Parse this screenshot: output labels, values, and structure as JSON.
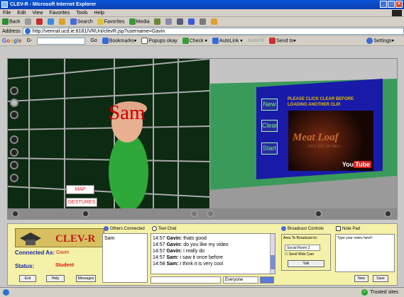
{
  "window": {
    "title": "CLEV-R - Microsoft Internet Explorer",
    "buttons": [
      "_",
      "□",
      "×"
    ]
  },
  "menu": [
    "File",
    "Edit",
    "View",
    "Favorites",
    "Tools",
    "Help"
  ],
  "toolbar": {
    "back": "Back",
    "search": "Search",
    "favorites": "Favorites",
    "media": "Media"
  },
  "address": {
    "label": "Address",
    "url": "http://vermal.ucd.ie:8181/VRUni/clevR.jsp?username=Gavin"
  },
  "google": {
    "logo": "Google",
    "g_label": "G-",
    "go": "Go",
    "bookmarks": "Bookmarks▾",
    "popups": "Popups okay",
    "check": "Check ▾",
    "autolink": "AutoLink ▾",
    "autofill": "AutoFill",
    "sendto": "Send to▾",
    "settings": "Settings▾"
  },
  "scene": {
    "avatar_name": "Sam",
    "map_button": "MAP",
    "gestures_button": "GESTURES",
    "panel_buttons": {
      "new": "New",
      "clear": "Clear",
      "start": "Start"
    },
    "note": "PLEASE CLICK CLEAR BEFORE LOADING ANOTHER CLIP.",
    "video": {
      "title": "Meat Loaf",
      "subtitle": "HITS OUT OF HELL",
      "brand_you": "You",
      "brand_tube": "Tube"
    }
  },
  "panel": {
    "brand": "CLEV-R",
    "connected_label": "Connected As:",
    "connected_value": "Gavin",
    "status_label": "Status:",
    "status_value": "Student",
    "buttons": {
      "exit": "Exit",
      "help": "Help",
      "messages": "Messages"
    },
    "others": {
      "title": "Others Connected",
      "users": [
        "Sam"
      ]
    },
    "chat": {
      "title": "Text Chat",
      "messages": [
        {
          "time": "14:57",
          "user": "Gavin:",
          "text": "thats good"
        },
        {
          "time": "14:57",
          "user": "Gavin:",
          "text": "do you like my video"
        },
        {
          "time": "14:57",
          "user": "Gavin:",
          "text": "i really do"
        },
        {
          "time": "14:57",
          "user": "Sam:",
          "text": "i saw it once before"
        },
        {
          "time": "14:58",
          "user": "Sam:",
          "text": "i think it is very cool"
        }
      ],
      "recipient": "Everyone"
    },
    "broadcast": {
      "title": "Broadcast Controls",
      "label": "Area To Broadcast to:",
      "room": "Social Room 2",
      "webcam": "Send Web Cam",
      "talk": "Talk"
    },
    "notepad": {
      "title": "Note Pad",
      "placeholder": "Type your notes here!!",
      "new": "New",
      "save": "Save"
    }
  },
  "statusbar": {
    "zone": "Trusted sites"
  }
}
